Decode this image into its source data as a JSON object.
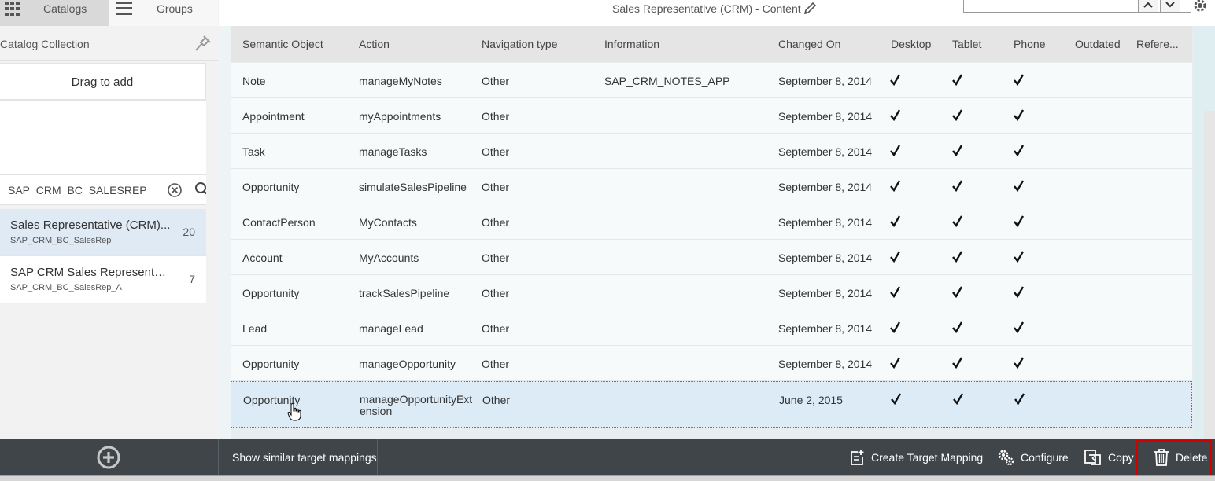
{
  "tabs": {
    "catalogs": "Catalogs",
    "groups": "Groups"
  },
  "header": {
    "title": "Sales Representative (CRM) - Content"
  },
  "left": {
    "collection_label": "Catalog Collection",
    "drag_label": "Drag to add",
    "search_value": "SAP_CRM_BC_SALESREP",
    "catalogs": [
      {
        "title": "Sales Representative (CRM)...",
        "subtitle": "SAP_CRM_BC_SalesRep",
        "count": "20",
        "selected": true
      },
      {
        "title": "SAP CRM Sales Representati...",
        "subtitle": "SAP_CRM_BC_SalesRep_A",
        "count": "7",
        "selected": false
      }
    ]
  },
  "table": {
    "columns": [
      "Semantic Object",
      "Action",
      "Navigation type",
      "Information",
      "Changed On",
      "Desktop",
      "Tablet",
      "Phone",
      "Outdated",
      "Refere..."
    ],
    "rows": [
      {
        "semantic_object": "Note",
        "action": "manageMyNotes",
        "nav_type": "Other",
        "information": "SAP_CRM_NOTES_APP",
        "changed_on": "September 8, 2014"
      },
      {
        "semantic_object": "Appointment",
        "action": "myAppointments",
        "nav_type": "Other",
        "information": "",
        "changed_on": "September 8, 2014"
      },
      {
        "semantic_object": "Task",
        "action": "manageTasks",
        "nav_type": "Other",
        "information": "",
        "changed_on": "September 8, 2014"
      },
      {
        "semantic_object": "Opportunity",
        "action": "simulateSalesPipeline",
        "nav_type": "Other",
        "information": "",
        "changed_on": "September 8, 2014"
      },
      {
        "semantic_object": "ContactPerson",
        "action": "MyContacts",
        "nav_type": "Other",
        "information": "",
        "changed_on": "September 8, 2014"
      },
      {
        "semantic_object": "Account",
        "action": "MyAccounts",
        "nav_type": "Other",
        "information": "",
        "changed_on": "September 8, 2014"
      },
      {
        "semantic_object": "Opportunity",
        "action": "trackSalesPipeline",
        "nav_type": "Other",
        "information": "",
        "changed_on": "September 8, 2014"
      },
      {
        "semantic_object": "Lead",
        "action": "manageLead",
        "nav_type": "Other",
        "information": "",
        "changed_on": "September 8, 2014"
      },
      {
        "semantic_object": "Opportunity",
        "action": "manageOpportunity",
        "nav_type": "Other",
        "information": "",
        "changed_on": "September 8, 2014"
      },
      {
        "semantic_object": "Opportunity",
        "action": "manageOpportunityExtension",
        "nav_type": "Other",
        "information": "",
        "changed_on": "June 2, 2015"
      }
    ]
  },
  "footer": {
    "similar": "Show similar target mappings",
    "create": "Create Target Mapping",
    "configure": "Configure",
    "copy": "Copy",
    "delete": "Delete"
  },
  "colors": {
    "footer_bg": "#3f4549",
    "selected_row": "#dcebf6",
    "highlight_frame": "#d40000"
  }
}
